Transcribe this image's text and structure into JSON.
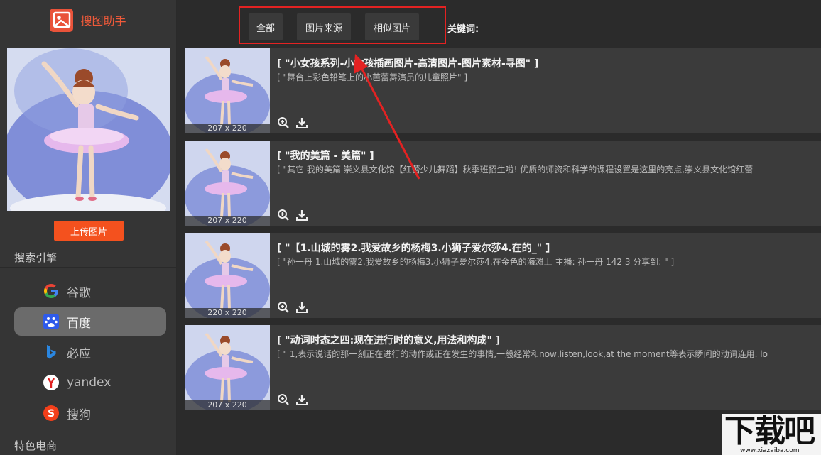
{
  "app": {
    "title": "搜图助手"
  },
  "sidebar": {
    "upload_label": "上传图片",
    "engines_title": "搜索引擎",
    "engines": [
      {
        "label": "谷歌",
        "icon": "google-icon",
        "active": false
      },
      {
        "label": "百度",
        "icon": "baidu-paw-icon",
        "active": true
      },
      {
        "label": "必应",
        "icon": "bing-icon",
        "active": false
      },
      {
        "label": "yandex",
        "icon": "yandex-icon",
        "active": false
      },
      {
        "label": "搜狗",
        "icon": "sogou-icon",
        "active": false
      }
    ],
    "shop_title": "特色电商"
  },
  "tabs": [
    {
      "label": "全部"
    },
    {
      "label": "图片来源"
    },
    {
      "label": "相似图片"
    }
  ],
  "keyword_label": "关键词:",
  "results": [
    {
      "dim": "207 x 220",
      "title": "[ \"小女孩系列-小女孩插画图片-高清图片-图片素材-寻图\" ]",
      "desc": "[ \"舞台上彩色铅笔上的小芭蕾舞演员的儿童照片\" ]"
    },
    {
      "dim": "207 x 220",
      "title": "[ \"我的美篇 - 美篇\" ]",
      "desc": "[ \"其它 我的美篇 崇义县文化馆【红蕾少儿舞蹈】秋季班招生啦! 优质的师资和科学的课程设置是这里的亮点,崇义县文化馆红蕾"
    },
    {
      "dim": "220 x 220",
      "title": "[ \"【1.山城的雾2.我爱故乡的杨梅3.小狮子爱尔莎4.在的_\" ]",
      "desc": "[ \"孙一丹 1.山城的雾2.我爱故乡的杨梅3.小狮子爱尔莎4.在金色的海滩上 主播: 孙一丹 142 3 分享到: \" ]"
    },
    {
      "dim": "207 x 220",
      "title": "[ \"动词时态之四:现在进行时的意义,用法和构成\" ]",
      "desc": "[ \" 1,表示说话的那一刻正在进行的动作或正在发生的事情,一般经常和now,listen,look,at the moment等表示瞬间的动词连用. lo"
    }
  ],
  "watermark": {
    "big": "下载吧",
    "small": "www.xiazaiba.com"
  },
  "colors": {
    "accent": "#f4511e",
    "highlight": "#e32222",
    "sidebar_bg": "#353535",
    "main_bg": "#2b2b2b",
    "row_bg": "#3b3b3b"
  }
}
